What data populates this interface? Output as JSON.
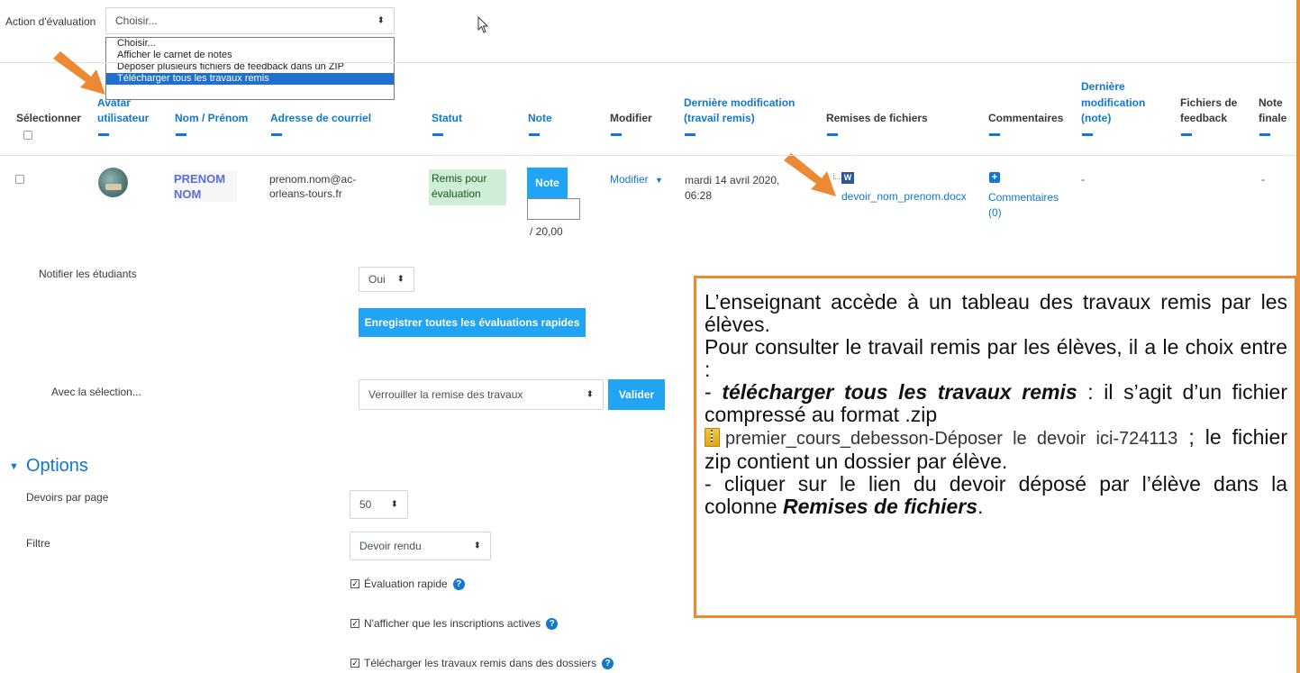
{
  "toolbar": {
    "action_label": "Action d'évaluation",
    "action_select_value": "Choisir...",
    "options": [
      "Choisir...",
      "Afficher le carnet de notes",
      "Déposer plusieurs fichiers de feedback dans un ZIP",
      "Télécharger tous les travaux remis"
    ],
    "selected_option_index": 3
  },
  "table": {
    "headers": {
      "select": "Sélectionner",
      "avatar_top": "Avatar",
      "avatar_bottom": "utilisateur",
      "name": "Nom / Prénom",
      "email": "Adresse de courriel",
      "status": "Statut",
      "grade": "Note",
      "edit": "Modifier",
      "lastmod_1": "Dernière modification",
      "lastmod_2": "(travail remis)",
      "files": "Remises de fichiers",
      "comments": "Commentaires",
      "gmod_1": "Dernière",
      "gmod_2": "modification",
      "gmod_3": "(note)",
      "feedback_1": "Fichiers de",
      "feedback_2": "feedback",
      "final_1": "Note",
      "final_2": "finale"
    },
    "row": {
      "name_1": "PRENOM",
      "name_2": "NOM",
      "email_1": "prenom.nom@ac-",
      "email_2": "orleans-tours.fr",
      "status_1": "Remis pour",
      "status_2": "évaluation",
      "grade_button": "Note",
      "grade_max": "/ 20,00",
      "edit": "Modifier",
      "date_1": "mardi 14 avril 2020,",
      "date_2": "06:28",
      "file": "devoir_nom_prenom.docx",
      "comments_1": "Commentaires",
      "comments_2": "(0)",
      "grade_mod": "-",
      "final": "-"
    }
  },
  "quickgrading": {
    "notify_label": "Notifier les étudiants",
    "notify_value": "Oui",
    "save_all": "Enregistrer toutes les évaluations rapides",
    "with_selection_label": "Avec la sélection...",
    "with_selection_value": "Verrouiller la remise des travaux",
    "validate": "Valider"
  },
  "options": {
    "title": "Options",
    "per_page_label": "Devoirs par page",
    "per_page_value": "50",
    "filter_label": "Filtre",
    "filter_value": "Devoir rendu",
    "quick_grading": "Évaluation rapide",
    "active_only": "N'afficher que les inscriptions actives",
    "download_folders": "Télécharger les travaux remis dans des dossiers"
  },
  "annotation": {
    "line1": "L’enseignant accède à un tableau des travaux remis par les élèves.",
    "line2": "Pour consulter le travail remis par les élèves, il a le choix entre :",
    "line3_prefix": "- ",
    "line3_bold": "télécharger tous les travaux remis",
    "line3_rest": " : il s’agit d’un fichier compressé au format .zip",
    "zip_name": "premier_cours_debesson-Déposer le devoir ici-724113",
    "line3_tail": " ; le fichier zip contient un dossier par élève.",
    "line4_prefix": "- cliquer sur le lien du devoir déposé par l’élève dans la colonne ",
    "line4_bold": "Remises de fichiers",
    "line4_end": "."
  },
  "colors": {
    "accent_blue": "#1177d1",
    "button_blue": "#20a4f3",
    "status_green": "#d4edda",
    "highlight_orange": "#ec8a34",
    "selected_option": "#1e6fcf"
  }
}
